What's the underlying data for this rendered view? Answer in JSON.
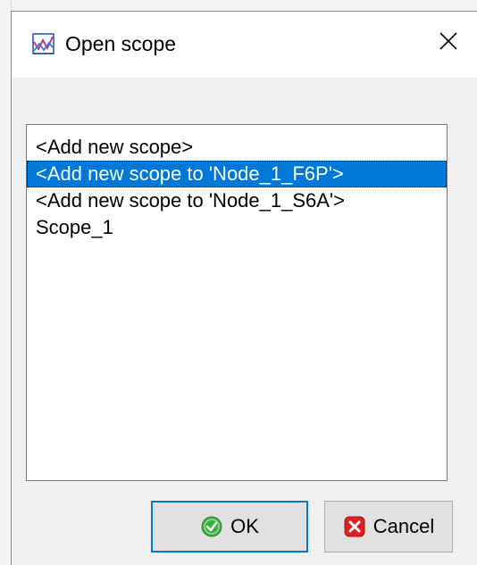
{
  "dialog": {
    "title": "Open scope",
    "title_icon": "scope-chart-icon",
    "close_icon": "close-icon"
  },
  "list": {
    "items": [
      {
        "label": "<Add new scope>",
        "selected": false
      },
      {
        "label": "<Add new scope to 'Node_1_F6P'>",
        "selected": true
      },
      {
        "label": "<Add new scope to 'Node_1_S6A'>",
        "selected": false
      },
      {
        "label": "Scope_1",
        "selected": false
      }
    ]
  },
  "buttons": {
    "ok_label": "OK",
    "ok_icon": "check-circle-icon",
    "cancel_label": "Cancel",
    "cancel_icon": "cancel-x-icon"
  },
  "colors": {
    "selection": "#0078d7",
    "dialog_bg": "#f0f0f0",
    "ok_icon_green": "#3cb043",
    "cancel_icon_red": "#e02020"
  }
}
